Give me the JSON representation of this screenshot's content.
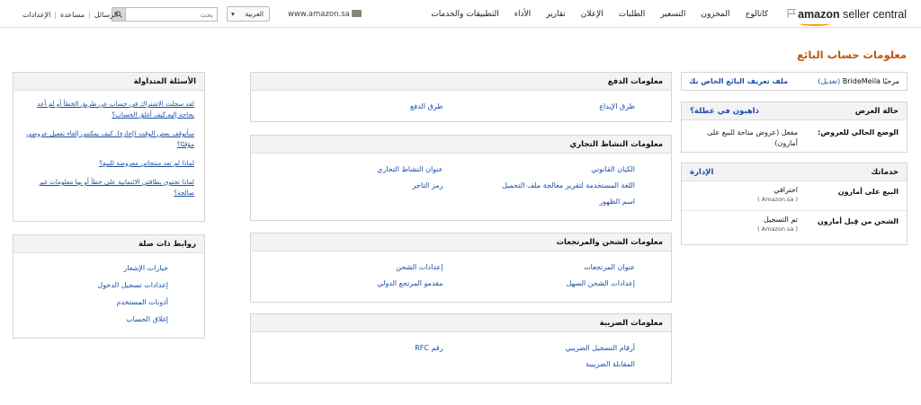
{
  "header": {
    "brand_bold": "amazon",
    "brand_rest": "seller central",
    "nav": [
      "كاتالوج",
      "المخزون",
      "التسعير",
      "الطلبات",
      "الإعلان",
      "تقارير",
      "الأداء",
      "التطبيقات والخدمات"
    ],
    "marketplace": "www.amazon.sa",
    "language": "العربية",
    "search_placeholder": "بحث",
    "links": [
      "الرسائل",
      "مساعدة",
      "الإعدادات"
    ]
  },
  "page_title": "معلومات حساب البائع",
  "welcome": {
    "greeting": "مرحبًا BrideMeila",
    "edit": "(تعديل)",
    "profile_link": "ملف تعريف البائع الخاص بك"
  },
  "display_status": {
    "title": "حالة العرض",
    "link": "ذاهبون في عطلة؟",
    "label": "الوضع الحالي للعروض:",
    "value": "مفعل (عروض متاحة للبيع على أمازون)"
  },
  "services": {
    "title": "خدماتك",
    "link": "الإدارة",
    "items": [
      {
        "label": "البيع على أمازون",
        "value": "احترافي",
        "sub": "( Amazon.sa )"
      },
      {
        "label": "الشحن من قِبل أمازون",
        "value": "تم التسجيل",
        "sub": "( Amazon.sa )"
      }
    ]
  },
  "payment": {
    "title": "معلومات الدفع",
    "col1": [
      "طرق الإيداع"
    ],
    "col2": [
      "طرق الدفع"
    ]
  },
  "business": {
    "title": "معلومات النشاط التجاري",
    "col1": [
      "الكيان القانوني",
      "اللغة المستخدمة لتقرير معالجة ملف التحميل",
      "اسم الظهور"
    ],
    "col2": [
      "عنوان النشاط التجاري",
      "رمز التاجر"
    ]
  },
  "shipping": {
    "title": "معلومات الشحن والمرتجعات",
    "col1": [
      "عنوان المرتجعات",
      "إعدادات الشحن السهل"
    ],
    "col2": [
      "إعدادات الشحن",
      "مقدمو المرتجع الدولي"
    ]
  },
  "tax": {
    "title": "معلومات الضريبة",
    "col1": [
      "أرقام التسجيل الضريبي",
      "المقابلة الضريبية"
    ],
    "col2": [
      "رقم RFC"
    ]
  },
  "faq": {
    "title": "الأسئلة المتداولة",
    "questions": [
      "لقد سجلت الاشتراك في حساب عن طريق الخطأ أو لم أعد بحاجة إليه.كيف أغلق الحساب؟",
      "سأتوقف بعض الوقت (إجازة). كيف يمكنني إلغاء تفعيل عروضي مؤقتًا؟",
      "لماذا لم تعد منتجاتي معروضة للبيع؟",
      "لماذا تحتوي بطاقتي الائتمانية على خطأ أو بها معلومات غير صالحة؟"
    ]
  },
  "related": {
    "title": "روابط ذات صلة",
    "links": [
      "خيارات الإشعار",
      "إعدادات تسجيل الدخول",
      "أذونات المستخدم",
      "إغلاق الحساب"
    ]
  }
}
